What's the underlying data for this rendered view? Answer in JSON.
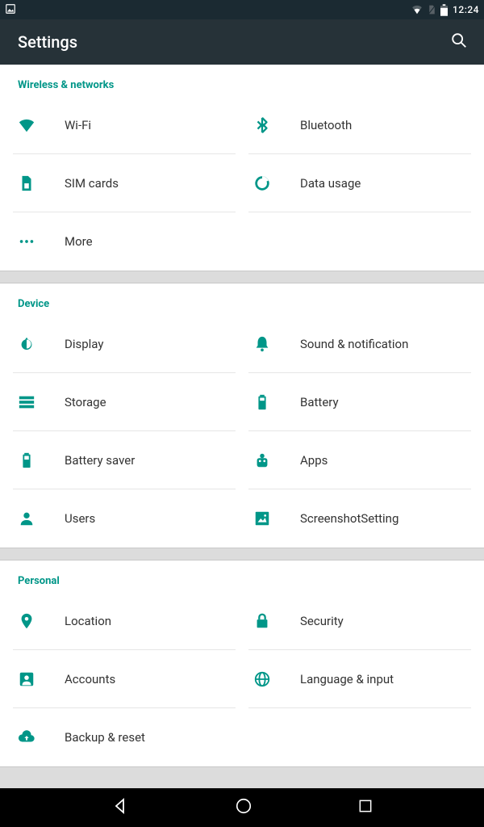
{
  "status": {
    "time": "12:24"
  },
  "appbar": {
    "title": "Settings"
  },
  "sections": {
    "wireless": {
      "header": "Wireless & networks",
      "wifi": "Wi-Fi",
      "bluetooth": "Bluetooth",
      "sim": "SIM cards",
      "data": "Data usage",
      "more": "More"
    },
    "device": {
      "header": "Device",
      "display": "Display",
      "sound": "Sound & notification",
      "storage": "Storage",
      "battery": "Battery",
      "saver": "Battery saver",
      "apps": "Apps",
      "users": "Users",
      "screenshot": "ScreenshotSetting"
    },
    "personal": {
      "header": "Personal",
      "location": "Location",
      "security": "Security",
      "accounts": "Accounts",
      "language": "Language & input",
      "backup": "Backup & reset"
    }
  }
}
